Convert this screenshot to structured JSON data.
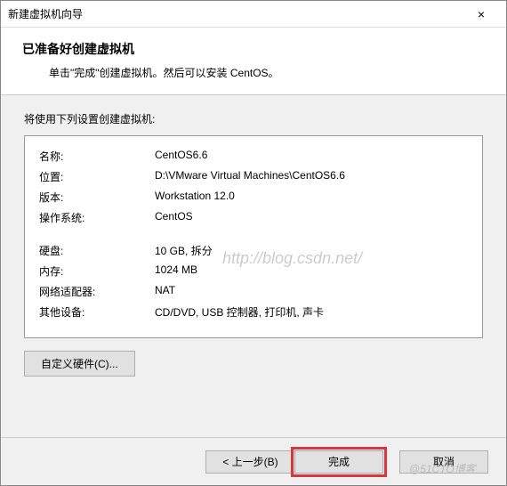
{
  "window": {
    "title": "新建虚拟机向导",
    "close": "×"
  },
  "header": {
    "heading": "已准备好创建虚拟机",
    "subtext": "单击\"完成\"创建虚拟机。然后可以安装 CentOS。"
  },
  "content": {
    "prompt": "将使用下列设置创建虚拟机:",
    "rows": {
      "name_label": "名称:",
      "name_value": "CentOS6.6",
      "location_label": "位置:",
      "location_value": "D:\\VMware Virtual Machines\\CentOS6.6",
      "version_label": "版本:",
      "version_value": "Workstation 12.0",
      "os_label": "操作系统:",
      "os_value": "CentOS",
      "disk_label": "硬盘:",
      "disk_value": "10 GB, 拆分",
      "memory_label": "内存:",
      "memory_value": "1024 MB",
      "net_label": "网络适配器:",
      "net_value": "NAT",
      "other_label": "其他设备:",
      "other_value": "CD/DVD, USB 控制器, 打印机, 声卡"
    },
    "customize_btn": "自定义硬件(C)..."
  },
  "footer": {
    "back": "< 上一步(B)",
    "finish": "完成",
    "cancel": "取消"
  },
  "watermark": {
    "main": "http://blog.csdn.net/",
    "corner": "@51CTO博客"
  }
}
